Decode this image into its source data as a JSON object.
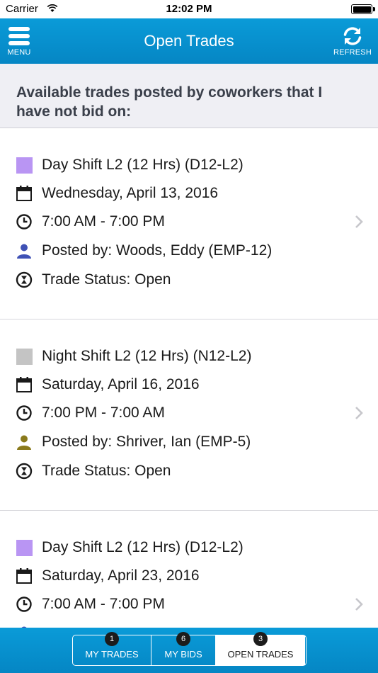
{
  "status_bar": {
    "carrier": "Carrier",
    "time": "12:02 PM"
  },
  "nav": {
    "title": "Open Trades",
    "menu_label": "MENU",
    "refresh_label": "REFRESH"
  },
  "subheader": "Available trades posted by coworkers that I have not bid on:",
  "trades": [
    {
      "shift": "Day Shift L2 (12 Hrs) (D12-L2)",
      "shift_color": "#b995f3",
      "date": "Wednesday, April 13, 2016",
      "time": "7:00 AM - 7:00 PM",
      "posted_by": "Posted by: Woods, Eddy (EMP-12)",
      "poster_color": "#3f51b5",
      "status": "Trade Status: Open"
    },
    {
      "shift": "Night Shift L2 (12 Hrs) (N12-L2)",
      "shift_color": "#c4c4c4",
      "date": "Saturday, April 16, 2016",
      "time": "7:00 PM - 7:00 AM",
      "posted_by": "Posted by: Shriver, Ian (EMP-5)",
      "poster_color": "#8a7a1c",
      "status": "Trade Status: Open"
    },
    {
      "shift": "Day Shift L2 (12 Hrs) (D12-L2)",
      "shift_color": "#b995f3",
      "date": "Saturday, April 23, 2016",
      "time": "7:00 AM - 7:00 PM",
      "posted_by": "",
      "poster_color": "#3f51b5",
      "status": ""
    }
  ],
  "tabs": [
    {
      "label": "MY TRADES",
      "badge": "1",
      "active": false
    },
    {
      "label": "MY BIDS",
      "badge": "6",
      "active": false
    },
    {
      "label": "OPEN TRADES",
      "badge": "3",
      "active": true
    }
  ],
  "colors": {
    "nav_blue": "#0a9bd8",
    "text": "#1a1a1a",
    "chevron": "#c7c7cc"
  }
}
